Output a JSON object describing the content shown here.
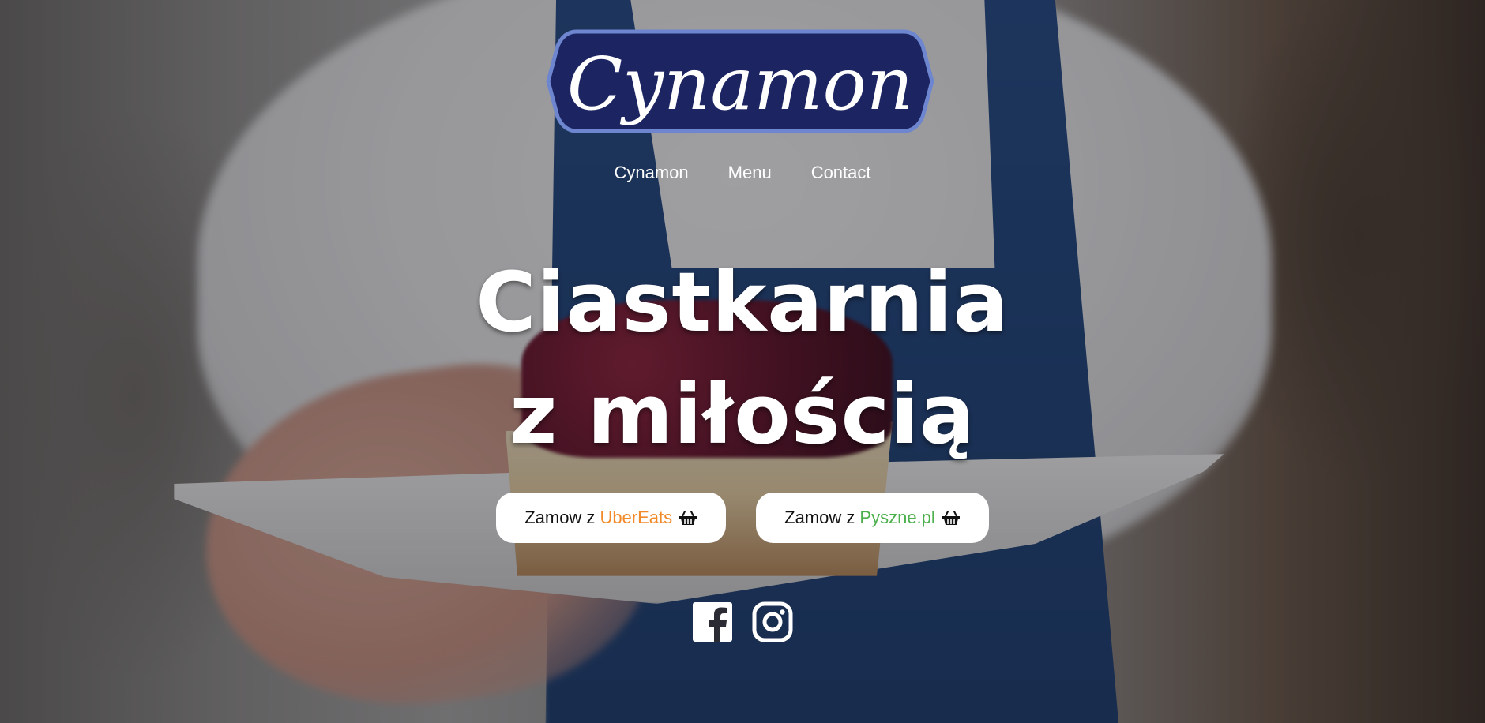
{
  "logo": {
    "text": "Cynamon"
  },
  "nav": {
    "items": [
      {
        "label": "Cynamon"
      },
      {
        "label": "Menu"
      },
      {
        "label": "Contact"
      }
    ]
  },
  "hero": {
    "line1": "Ciastkarnia",
    "line2": "z miłością"
  },
  "buttons": [
    {
      "prefix": "Zamow z",
      "brand": "UberEats",
      "brand_color": "#f28a2a",
      "icon": "basket-icon"
    },
    {
      "prefix": "Zamow z",
      "brand": "Pyszne.pl",
      "brand_color": "#4cb04c",
      "icon": "basket-icon"
    }
  ],
  "social": [
    {
      "icon": "facebook-icon"
    },
    {
      "icon": "instagram-icon"
    }
  ],
  "colors": {
    "logo_bg": "#1c2461",
    "logo_border": "#6d86cf",
    "overlay": "rgba(20,20,25,0.38)"
  }
}
